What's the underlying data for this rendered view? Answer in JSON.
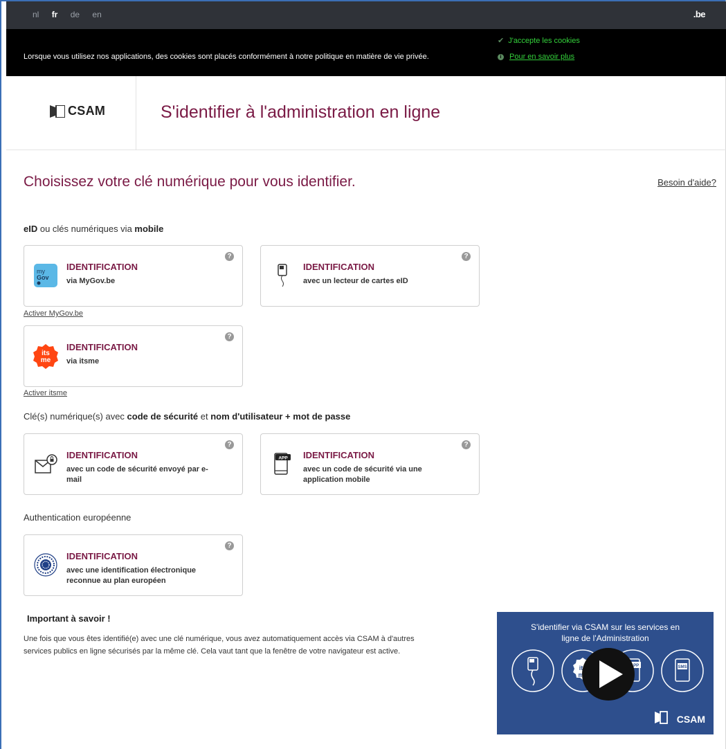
{
  "languages": [
    {
      "code": "nl",
      "active": false
    },
    {
      "code": "fr",
      "active": true
    },
    {
      "code": "de",
      "active": false
    },
    {
      "code": "en",
      "active": false
    }
  ],
  "domain_label": ".be",
  "cookie": {
    "message": "Lorsque vous utilisez nos applications, des cookies sont placés conformément à notre politique en matière de vie privée.",
    "accept_label": "J'accepte les cookies",
    "more_label": "Pour en savoir plus"
  },
  "header": {
    "logo_text": "CSAM",
    "title": "S'identifier à l'administration en ligne"
  },
  "main": {
    "heading": "Choisissez votre clé numérique pour vous identifier.",
    "help_link": "Besoin d'aide?"
  },
  "sections": {
    "eid": {
      "part1": "eID",
      "part2": " ou clés numériques via ",
      "part3": "mobile"
    },
    "code": {
      "part1": "Clé(s) numérique(s) avec ",
      "part2": "code de sécurité",
      "part3": " et ",
      "part4": "nom d'utilisateur + mot de passe"
    },
    "eu": {
      "label": "Authentication européenne"
    }
  },
  "cards": {
    "mygov": {
      "title": "IDENTIFICATION",
      "desc": "via MyGov.be",
      "icon": "mygov-icon",
      "icon_text_1": "my",
      "icon_text_2": "Gov"
    },
    "eid_reader": {
      "title": "IDENTIFICATION",
      "desc": "avec un lecteur de cartes eID",
      "icon": "card-reader-icon"
    },
    "itsme": {
      "title": "IDENTIFICATION",
      "desc": "via itsme",
      "icon": "itsme-icon",
      "icon_text_1": "its",
      "icon_text_2": "me"
    },
    "email": {
      "title": "IDENTIFICATION",
      "desc": "avec un code de sécurité envoyé par e-mail",
      "icon": "email-lock-icon"
    },
    "app": {
      "title": "IDENTIFICATION",
      "desc": "avec un code de sécurité via une application mobile",
      "icon": "mobile-app-icon",
      "icon_text": "APP"
    },
    "eu": {
      "title": "IDENTIFICATION",
      "desc": "avec une identification électronique reconnue au plan européen",
      "icon": "eu-stars-icon"
    }
  },
  "help_icon": "?",
  "activate": {
    "mygov": "Activer MyGov.be",
    "itsme": "Activer itsme"
  },
  "important": {
    "heading": "Important à savoir !",
    "text": "Une fois que vous êtes identifié(e) avec une clé numérique, vous avez automatiquement accès via CSAM à d'autres services publics en ligne sécurisés par la même clé. Cela vaut tant que la fenêtre de votre navigateur est active."
  },
  "video": {
    "title_line1": "S'identifier via CSAM sur les services en",
    "title_line2": "ligne de l'Administration",
    "logo_text": "CSAM",
    "icon_texts": [
      "its",
      "me",
      "APP",
      "SMS"
    ]
  },
  "colors": {
    "brand": "#7a1a45",
    "topbar": "#2f3238",
    "cookie_link": "#34d13b",
    "video_bg": "#2e4f8d"
  }
}
